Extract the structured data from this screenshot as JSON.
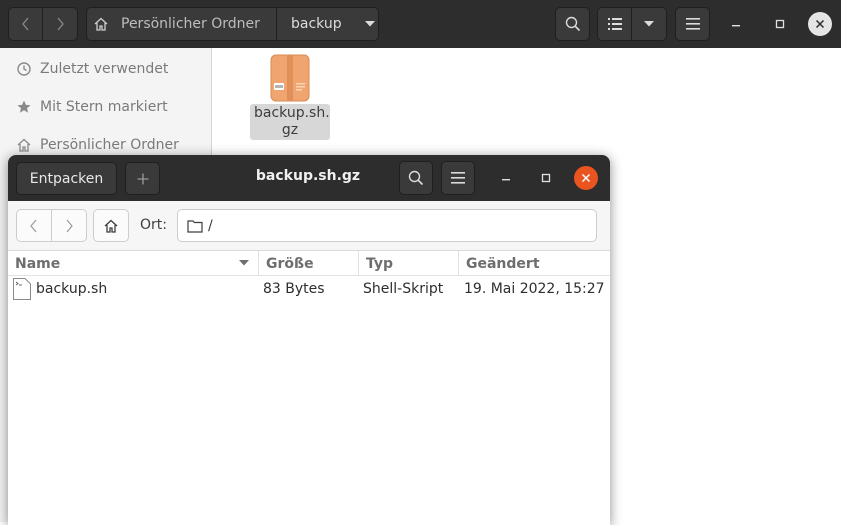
{
  "nautilus": {
    "pathbar": {
      "home_label": "Persönlicher Ordner",
      "current": "backup"
    },
    "sidebar": {
      "items": [
        {
          "label": "Zuletzt verwendet",
          "icon": "clock-icon"
        },
        {
          "label": "Mit Stern markiert",
          "icon": "star-icon"
        },
        {
          "label": "Persönlicher Ordner",
          "icon": "home-icon"
        }
      ]
    },
    "files": [
      {
        "name": "backup.sh.\ngz",
        "icon": "archive-package-icon",
        "color": "#f0a570"
      }
    ]
  },
  "archive_manager": {
    "title": "backup.sh.gz",
    "extract_label": "Entpacken",
    "location_label": "Ort:",
    "location_path": "/",
    "columns": [
      "Name",
      "Größe",
      "Typ",
      "Geändert"
    ],
    "rows": [
      {
        "name": "backup.sh",
        "size": "83 Bytes",
        "type": "Shell-Skript",
        "modified": "19. Mai 2022, 15:27"
      }
    ],
    "close_color": "#e95420"
  }
}
